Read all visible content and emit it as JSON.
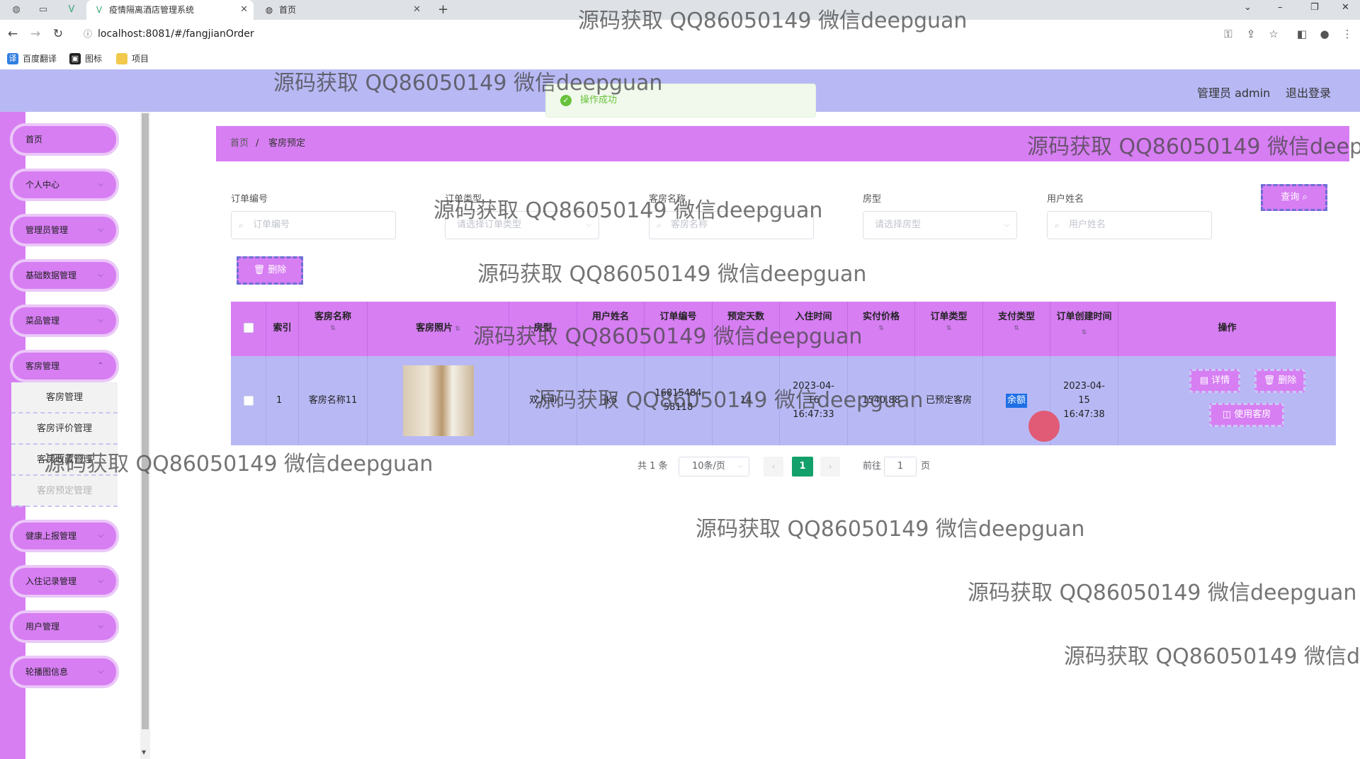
{
  "browser": {
    "tabs": [
      {
        "title": "疫情隔离酒店管理系统",
        "active": true
      },
      {
        "title": "首页",
        "active": false
      }
    ],
    "url": "localhost:8081/#/fangjianOrder",
    "bookmarks": [
      "百度翻译",
      "图标",
      "项目"
    ]
  },
  "header": {
    "admin_label": "管理员 admin",
    "logout_label": "退出登录"
  },
  "toast": {
    "message": "操作成功"
  },
  "sidebar": {
    "items": [
      {
        "label": "首页"
      },
      {
        "label": "个人中心"
      },
      {
        "label": "管理员管理"
      },
      {
        "label": "基础数据管理"
      },
      {
        "label": "菜品管理"
      },
      {
        "label": "客房管理"
      },
      {
        "label": "健康上报管理"
      },
      {
        "label": "入住记录管理"
      },
      {
        "label": "用户管理"
      },
      {
        "label": "轮播图信息"
      }
    ],
    "submenu": [
      "客房管理",
      "客房评价管理",
      "客房收藏管理",
      "客房预定管理"
    ]
  },
  "breadcrumb": {
    "home": "首页",
    "separator": "/",
    "current": "客房预定"
  },
  "filters": {
    "order_no": {
      "label": "订单编号",
      "placeholder": "订单编号"
    },
    "order_type": {
      "label": "订单类型",
      "placeholder": "请选择订单类型"
    },
    "room_name": {
      "label": "客房名称",
      "placeholder": "客房名称"
    },
    "room_type": {
      "label": "房型",
      "placeholder": "请选择房型"
    },
    "user_name": {
      "label": "用户姓名",
      "placeholder": "用户姓名"
    },
    "query_label": "查询",
    "delete_label": "删除"
  },
  "table": {
    "columns": [
      "索引",
      "客房名称",
      "客房照片",
      "房型",
      "用户姓名",
      "订单编号",
      "预定天数",
      "入住时间",
      "实付价格",
      "订单类型",
      "支付类型",
      "订单创建时间",
      "操作"
    ],
    "rows": [
      {
        "index": "1",
        "room_name": "客房名称11",
        "room_type": "双人间",
        "user_name": "jk5",
        "order_no": "1681548458118",
        "days": "14",
        "checkin": "2023-04-16 16:47:33",
        "price": "1540.88",
        "order_type": "已预定客房",
        "pay_type": "余额",
        "created": "2023-04-15 16:47:38"
      }
    ],
    "actions": {
      "detail": "详情",
      "delete": "删除",
      "use_room": "使用客房"
    }
  },
  "pagination": {
    "total_text": "共 1 条",
    "page_size": "10条/页",
    "current_page": "1",
    "goto_prefix": "前往",
    "goto_value": "1",
    "goto_suffix": "页"
  },
  "watermark": "源码获取 QQ86050149 微信deepguan",
  "colors": {
    "accent": "#d77ef3",
    "header": "#b8b9f4",
    "success": "#67c23a",
    "page_active": "#13a06a"
  }
}
